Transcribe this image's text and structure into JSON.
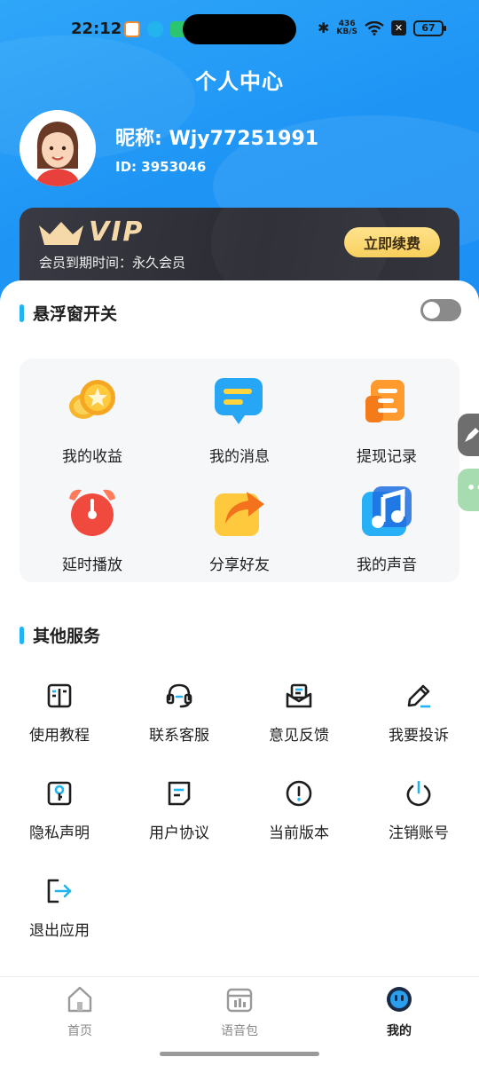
{
  "status_bar": {
    "time": "22:12",
    "net_speed_value": "436",
    "net_speed_unit": "KB/S",
    "battery": "67"
  },
  "header": {
    "title": "个人中心"
  },
  "profile": {
    "nickname": "昵称: Wjy77251991",
    "user_id": "ID: 3953046"
  },
  "vip": {
    "badge": "VIP",
    "expire_text": "会员到期时间：永久会员",
    "renew_button": "立即续费"
  },
  "floating_window": {
    "label": "悬浮窗开关",
    "enabled": false
  },
  "features": [
    {
      "label": "我的收益",
      "icon": "coins-icon"
    },
    {
      "label": "我的消息",
      "icon": "message-icon"
    },
    {
      "label": "提现记录",
      "icon": "withdraw-record-icon"
    },
    {
      "label": "延时播放",
      "icon": "alarm-clock-icon"
    },
    {
      "label": "分享好友",
      "icon": "share-icon"
    },
    {
      "label": "我的声音",
      "icon": "music-note-icon"
    }
  ],
  "services": {
    "title": "其他服务",
    "items": [
      {
        "label": "使用教程",
        "icon": "book-icon"
      },
      {
        "label": "联系客服",
        "icon": "headset-icon"
      },
      {
        "label": "意见反馈",
        "icon": "feedback-icon"
      },
      {
        "label": "我要投诉",
        "icon": "pen-icon"
      },
      {
        "label": "隐私声明",
        "icon": "privacy-key-icon"
      },
      {
        "label": "用户协议",
        "icon": "document-icon"
      },
      {
        "label": "当前版本",
        "icon": "info-icon"
      },
      {
        "label": "注销账号",
        "icon": "power-icon"
      },
      {
        "label": "退出应用",
        "icon": "logout-icon"
      }
    ]
  },
  "bottom_nav": {
    "items": [
      {
        "label": "首页",
        "icon": "home-icon",
        "active": false
      },
      {
        "label": "语音包",
        "icon": "voice-pack-icon",
        "active": false
      },
      {
        "label": "我的",
        "icon": "profile-icon",
        "active": true
      }
    ]
  },
  "colors": {
    "header_blue": "#1e95f5",
    "accent": "#22b3f2",
    "vip_gold": "#f8cf5a",
    "vip_card": "#2b2b33"
  }
}
